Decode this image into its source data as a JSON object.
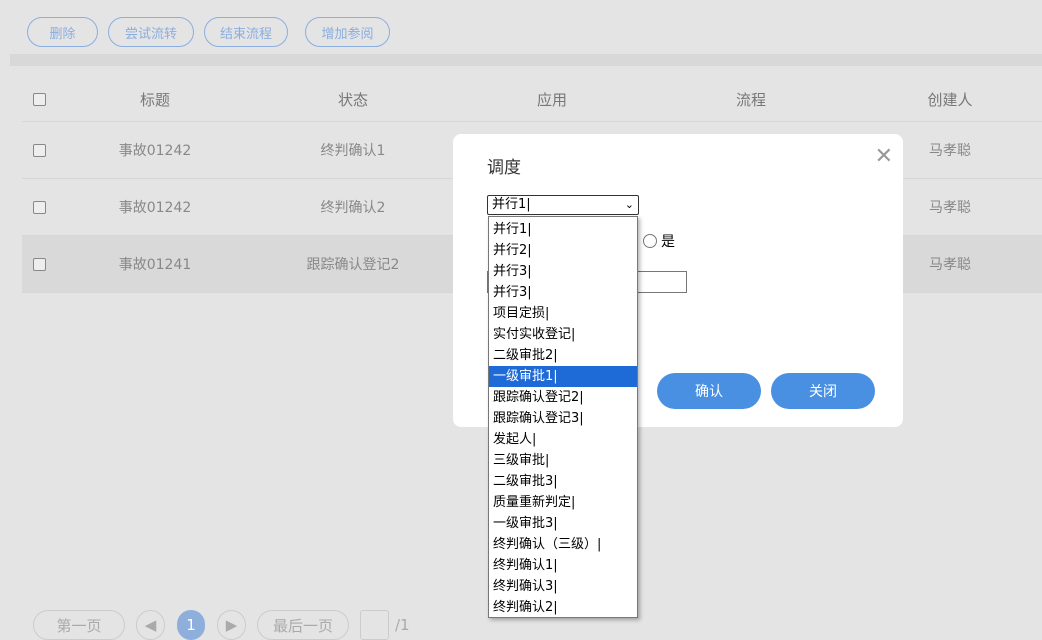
{
  "toolbar": {
    "delete": "删除",
    "try_flow": "尝试流转",
    "end_flow": "结束流程",
    "add_ref": "增加参阅"
  },
  "table": {
    "headers": [
      "标题",
      "状态",
      "应用",
      "流程",
      "创建人"
    ],
    "rows": [
      {
        "title": "事故01242",
        "status": "终判确认1",
        "creator": "马孝聪"
      },
      {
        "title": "事故01242",
        "status": "终判确认2",
        "creator": "马孝聪"
      },
      {
        "title": "事故01241",
        "status": "跟踪确认登记2",
        "creator": "马孝聪"
      }
    ]
  },
  "pagination": {
    "first": "第一页",
    "current": "1",
    "last": "最后一页",
    "total": "/1"
  },
  "dialog": {
    "title": "调度",
    "selected": "并行1|",
    "radio_yes": "是",
    "confirm": "确认",
    "close": "关闭",
    "options": [
      "并行1|",
      "并行2|",
      "并行3|",
      "并行3|",
      "项目定损|",
      "实付实收登记|",
      "二级审批2|",
      "一级审批1|",
      "跟踪确认登记2|",
      "跟踪确认登记3|",
      "发起人|",
      "三级审批|",
      "二级审批3|",
      "质量重新判定|",
      "一级审批3|",
      "终判确认（三级）|",
      "终判确认1|",
      "终判确认3|",
      "终判确认2|"
    ],
    "highlighted_index": 7
  }
}
